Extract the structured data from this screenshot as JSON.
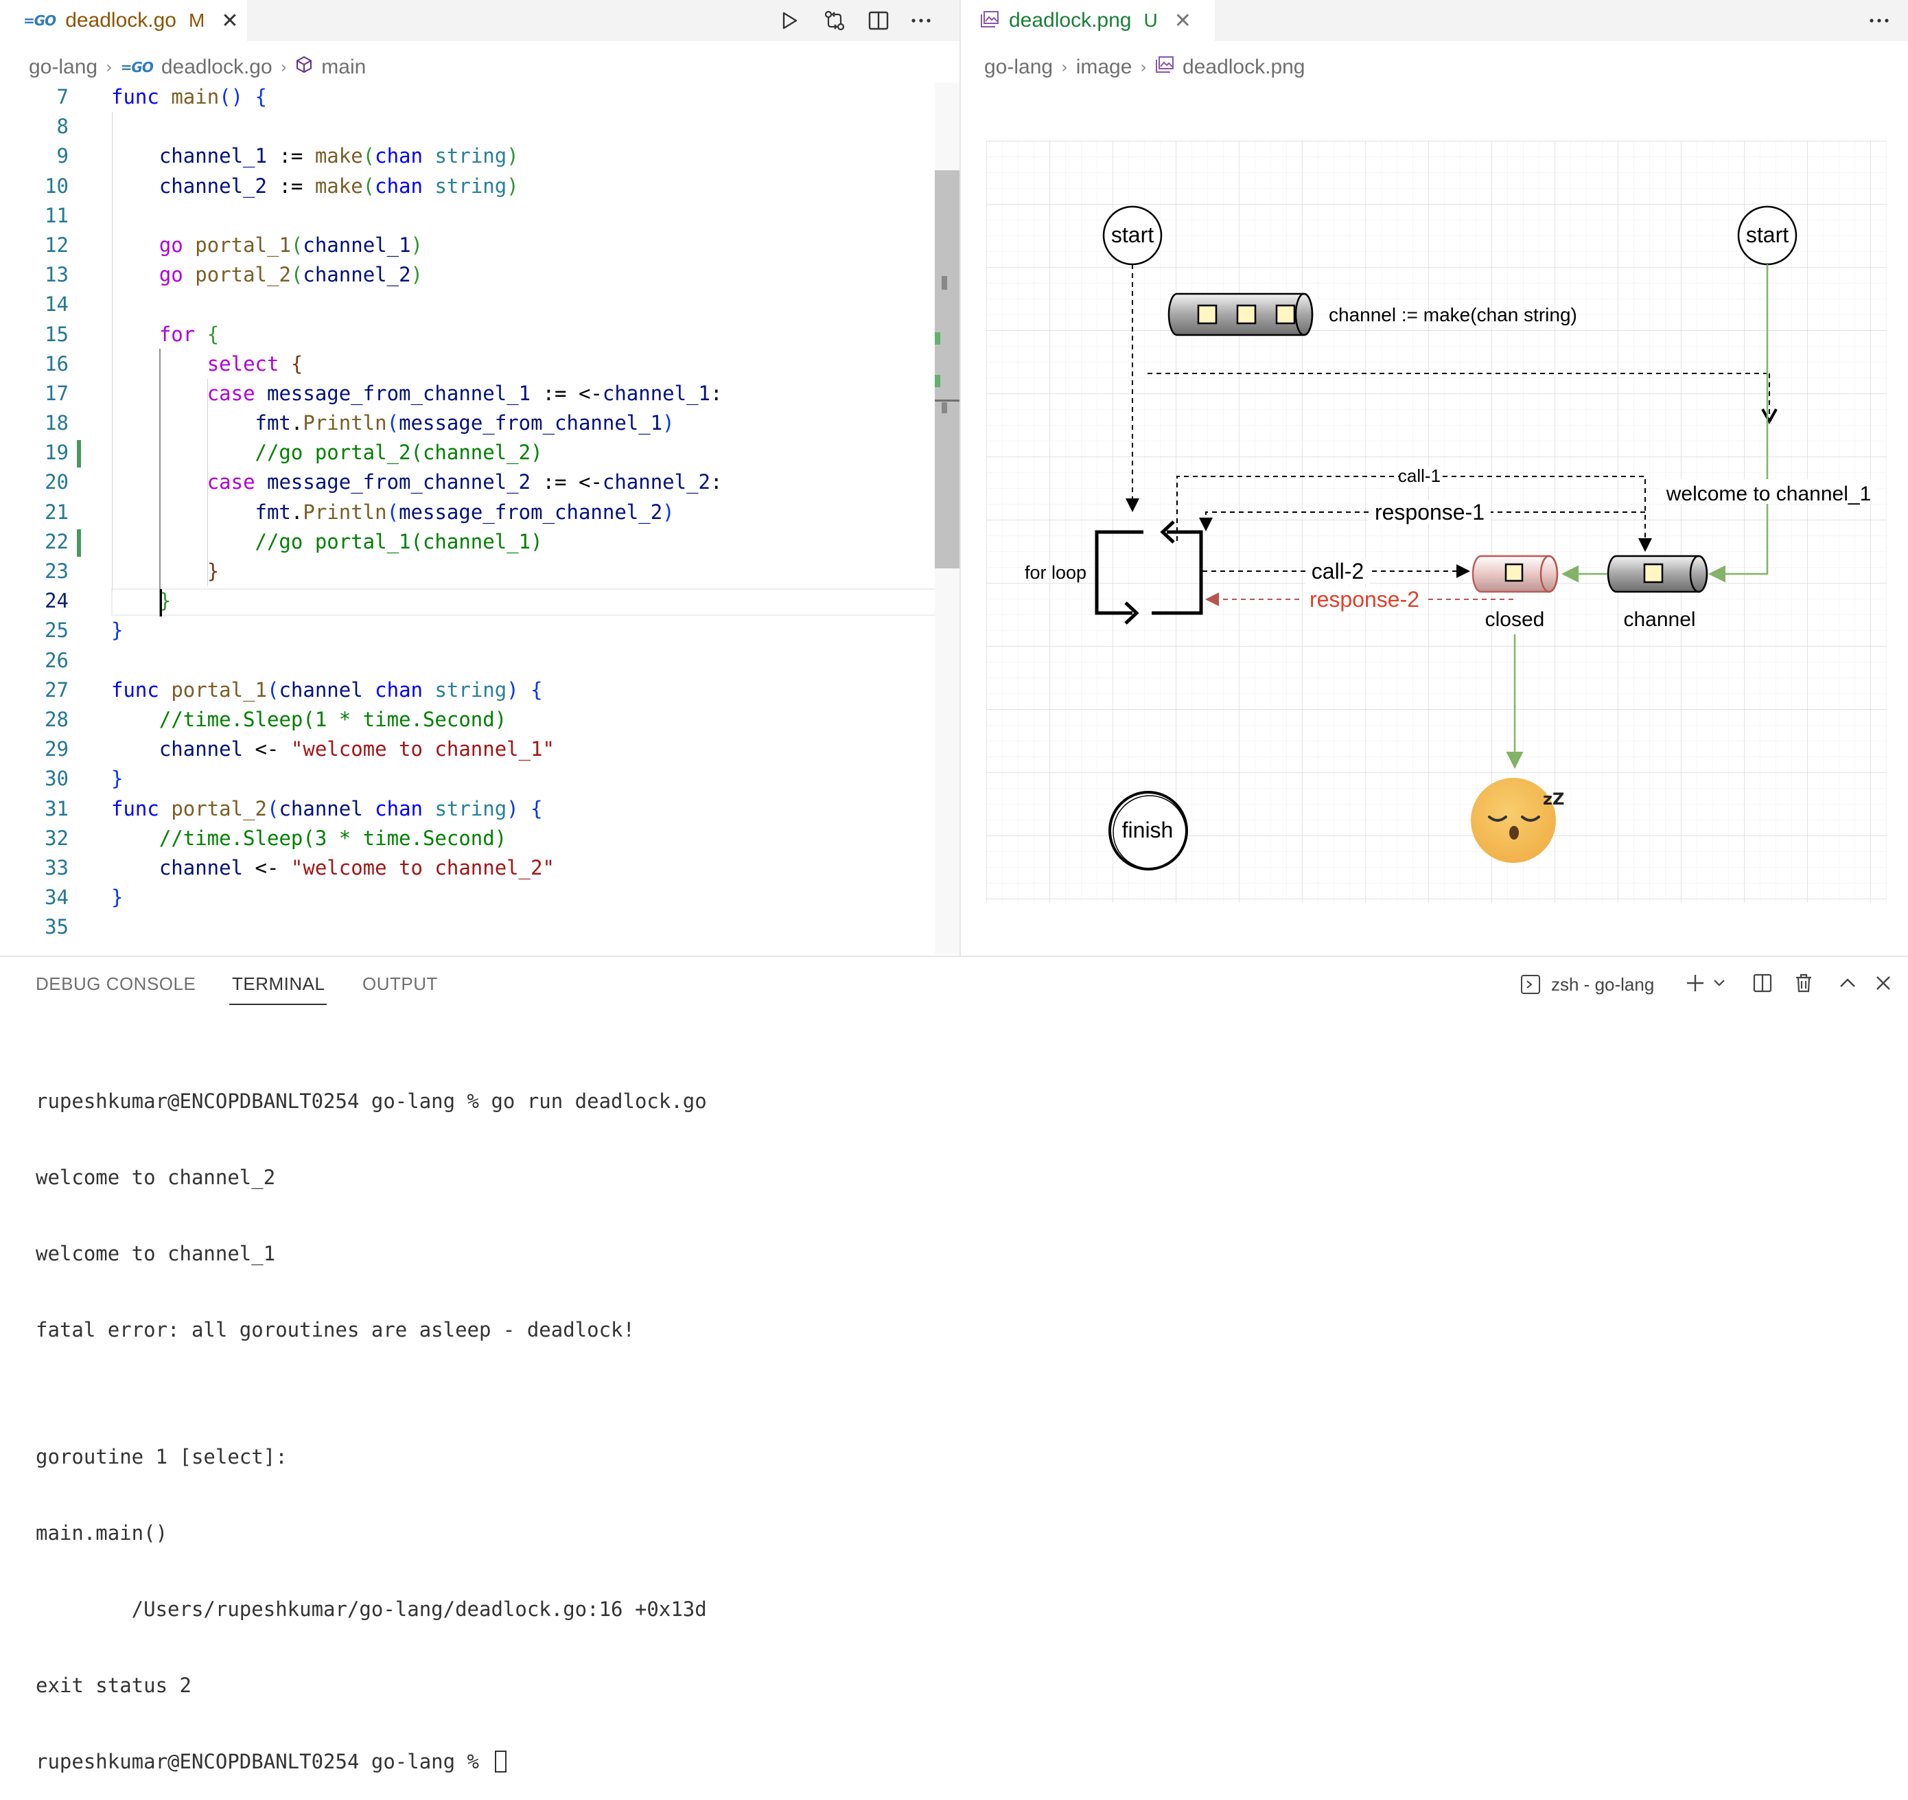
{
  "colors": {
    "tab_modified": "#895503",
    "tab_untracked": "#1a7f37",
    "line_number": "#237893",
    "keyword": "#af00db",
    "keyword_blue": "#0000ff",
    "function": "#795e26",
    "type": "#267f99",
    "variable": "#001080",
    "string": "#a31515",
    "comment": "#008000",
    "diagram_green": "#82b366",
    "diagram_red": "#b85450",
    "response_red": "#e0402a"
  },
  "editor_left": {
    "tab": {
      "icon": "go-file-icon",
      "title": "deadlock.go",
      "status": "M"
    },
    "toolbar": [
      "run-icon",
      "compare-changes-icon",
      "split-editor-icon",
      "more-actions-icon"
    ],
    "breadcrumb": {
      "folder": "go-lang",
      "file": "deadlock.go",
      "symbol": "main"
    },
    "lines": [
      {
        "n": "7",
        "tokens": [
          [
            "kwb",
            "func"
          ],
          [
            "pl",
            " "
          ],
          [
            "fn",
            "main"
          ],
          [
            "br1",
            "()"
          ],
          [
            "pl",
            " "
          ],
          [
            "br1",
            "{"
          ]
        ]
      },
      {
        "n": "8",
        "tokens": []
      },
      {
        "n": "9",
        "tokens": [
          [
            "pl",
            "    "
          ],
          [
            "va",
            "channel_1"
          ],
          [
            "pl",
            " := "
          ],
          [
            "fn",
            "make"
          ],
          [
            "br2",
            "("
          ],
          [
            "kwb",
            "chan"
          ],
          [
            "pl",
            " "
          ],
          [
            "ty",
            "string"
          ],
          [
            "br2",
            ")"
          ]
        ]
      },
      {
        "n": "10",
        "tokens": [
          [
            "pl",
            "    "
          ],
          [
            "va",
            "channel_2"
          ],
          [
            "pl",
            " := "
          ],
          [
            "fn",
            "make"
          ],
          [
            "br2",
            "("
          ],
          [
            "kwb",
            "chan"
          ],
          [
            "pl",
            " "
          ],
          [
            "ty",
            "string"
          ],
          [
            "br2",
            ")"
          ]
        ]
      },
      {
        "n": "11",
        "tokens": []
      },
      {
        "n": "12",
        "tokens": [
          [
            "pl",
            "    "
          ],
          [
            "kw",
            "go"
          ],
          [
            "pl",
            " "
          ],
          [
            "fn",
            "portal_1"
          ],
          [
            "br2",
            "("
          ],
          [
            "va",
            "channel_1"
          ],
          [
            "br2",
            ")"
          ]
        ]
      },
      {
        "n": "13",
        "tokens": [
          [
            "pl",
            "    "
          ],
          [
            "kw",
            "go"
          ],
          [
            "pl",
            " "
          ],
          [
            "fn",
            "portal_2"
          ],
          [
            "br2",
            "("
          ],
          [
            "va",
            "channel_2"
          ],
          [
            "br2",
            ")"
          ]
        ]
      },
      {
        "n": "14",
        "tokens": []
      },
      {
        "n": "15",
        "tokens": [
          [
            "pl",
            "    "
          ],
          [
            "kw",
            "for"
          ],
          [
            "pl",
            " "
          ],
          [
            "br2",
            "{"
          ]
        ]
      },
      {
        "n": "16",
        "tokens": [
          [
            "pl",
            "        "
          ],
          [
            "kw",
            "select"
          ],
          [
            "pl",
            " "
          ],
          [
            "br3",
            "{"
          ]
        ]
      },
      {
        "n": "17",
        "tokens": [
          [
            "pl",
            "        "
          ],
          [
            "kw",
            "case"
          ],
          [
            "pl",
            " "
          ],
          [
            "va",
            "message_from_channel_1"
          ],
          [
            "pl",
            " := <-"
          ],
          [
            "va",
            "channel_1"
          ],
          [
            "pl",
            ":"
          ]
        ]
      },
      {
        "n": "18",
        "tokens": [
          [
            "pl",
            "            "
          ],
          [
            "va",
            "fmt"
          ],
          [
            "pl",
            "."
          ],
          [
            "fn",
            "Println"
          ],
          [
            "br1",
            "("
          ],
          [
            "va",
            "message_from_channel_1"
          ],
          [
            "br1",
            ")"
          ]
        ]
      },
      {
        "n": "19",
        "tokens": [
          [
            "pl",
            "            "
          ],
          [
            "cm",
            "//go portal_2(channel_2)"
          ]
        ]
      },
      {
        "n": "20",
        "tokens": [
          [
            "pl",
            "        "
          ],
          [
            "kw",
            "case"
          ],
          [
            "pl",
            " "
          ],
          [
            "va",
            "message_from_channel_2"
          ],
          [
            "pl",
            " := <-"
          ],
          [
            "va",
            "channel_2"
          ],
          [
            "pl",
            ":"
          ]
        ]
      },
      {
        "n": "21",
        "tokens": [
          [
            "pl",
            "            "
          ],
          [
            "va",
            "fmt"
          ],
          [
            "pl",
            "."
          ],
          [
            "fn",
            "Println"
          ],
          [
            "br1",
            "("
          ],
          [
            "va",
            "message_from_channel_2"
          ],
          [
            "br1",
            ")"
          ]
        ]
      },
      {
        "n": "22",
        "tokens": [
          [
            "pl",
            "            "
          ],
          [
            "cm",
            "//go portal_1(channel_1)"
          ]
        ]
      },
      {
        "n": "23",
        "tokens": [
          [
            "pl",
            "        "
          ],
          [
            "br3",
            "}"
          ]
        ]
      },
      {
        "n": "24",
        "tokens": [
          [
            "pl",
            "    "
          ],
          [
            "br2",
            "}"
          ]
        ]
      },
      {
        "n": "25",
        "tokens": [
          [
            "br1",
            "}"
          ]
        ]
      },
      {
        "n": "26",
        "tokens": []
      },
      {
        "n": "27",
        "tokens": [
          [
            "kwb",
            "func"
          ],
          [
            "pl",
            " "
          ],
          [
            "fn",
            "portal_1"
          ],
          [
            "br1",
            "("
          ],
          [
            "va",
            "channel"
          ],
          [
            "pl",
            " "
          ],
          [
            "kwb",
            "chan"
          ],
          [
            "pl",
            " "
          ],
          [
            "ty",
            "string"
          ],
          [
            "br1",
            ")"
          ],
          [
            "pl",
            " "
          ],
          [
            "br1",
            "{"
          ]
        ]
      },
      {
        "n": "28",
        "tokens": [
          [
            "pl",
            "    "
          ],
          [
            "cm",
            "//time.Sleep(1 * time.Second)"
          ]
        ]
      },
      {
        "n": "29",
        "tokens": [
          [
            "pl",
            "    "
          ],
          [
            "va",
            "channel"
          ],
          [
            "pl",
            " <- "
          ],
          [
            "str",
            "\"welcome to channel_1\""
          ]
        ]
      },
      {
        "n": "30",
        "tokens": [
          [
            "br1",
            "}"
          ]
        ]
      },
      {
        "n": "31",
        "tokens": [
          [
            "kwb",
            "func"
          ],
          [
            "pl",
            " "
          ],
          [
            "fn",
            "portal_2"
          ],
          [
            "br1",
            "("
          ],
          [
            "va",
            "channel"
          ],
          [
            "pl",
            " "
          ],
          [
            "kwb",
            "chan"
          ],
          [
            "pl",
            " "
          ],
          [
            "ty",
            "string"
          ],
          [
            "br1",
            ")"
          ],
          [
            "pl",
            " "
          ],
          [
            "br1",
            "{"
          ]
        ]
      },
      {
        "n": "32",
        "tokens": [
          [
            "pl",
            "    "
          ],
          [
            "cm",
            "//time.Sleep(3 * time.Second)"
          ]
        ]
      },
      {
        "n": "33",
        "tokens": [
          [
            "pl",
            "    "
          ],
          [
            "va",
            "channel"
          ],
          [
            "pl",
            " <- "
          ],
          [
            "str",
            "\"welcome to channel_2\""
          ]
        ]
      },
      {
        "n": "34",
        "tokens": [
          [
            "br1",
            "}"
          ]
        ]
      },
      {
        "n": "35",
        "tokens": []
      }
    ]
  },
  "editor_right": {
    "tab": {
      "icon": "image-file-icon",
      "title": "deadlock.png",
      "status": "U"
    },
    "breadcrumb": {
      "folder": "go-lang",
      "subfolder": "image",
      "file": "deadlock.png"
    }
  },
  "diagram": {
    "start_left": "start",
    "start_right": "start",
    "channel_decl": "channel := make(chan string)",
    "welcome_label": "welcome to channel_1",
    "call1": "call-1",
    "response1": "response-1",
    "call2": "call-2",
    "response2": "response-2",
    "for_loop": "for loop",
    "closed": "closed",
    "channel": "channel",
    "finish": "finish",
    "sleep_mark": "zZ"
  },
  "panel": {
    "tabs": [
      "DEBUG CONSOLE",
      "TERMINAL",
      "OUTPUT"
    ],
    "active_tab": "TERMINAL",
    "terminal_profile": "zsh - go-lang",
    "terminal_lines": [
      "rupeshkumar@ENCOPDBANLT0254 go-lang % go run deadlock.go",
      "welcome to channel_2",
      "welcome to channel_1",
      "fatal error: all goroutines are asleep - deadlock!",
      "",
      "goroutine 1 [select]:",
      "main.main()",
      "        /Users/rupeshkumar/go-lang/deadlock.go:16 +0x13d",
      "exit status 2"
    ],
    "prompt": "rupeshkumar@ENCOPDBANLT0254 go-lang % "
  }
}
